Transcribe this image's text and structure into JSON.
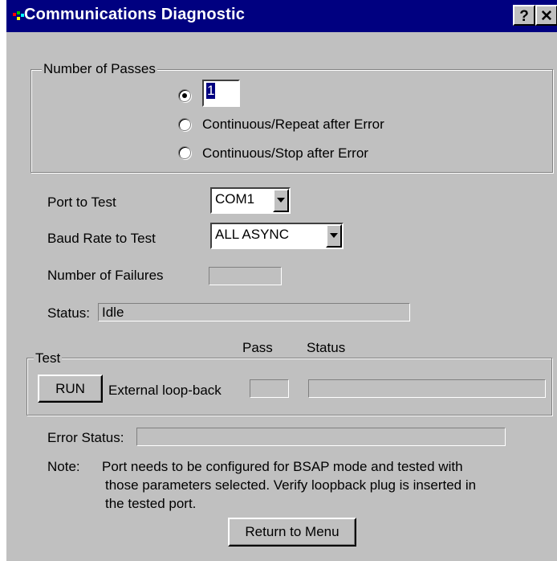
{
  "window": {
    "title": "Communications Diagnostic",
    "help_label": "?",
    "close_label": "✕"
  },
  "passes": {
    "group_title": "Number of Passes",
    "count_value": "1",
    "options": [
      "Continuous/Repeat after Error",
      "Continuous/Stop after  Error"
    ]
  },
  "port": {
    "label": "Port to Test",
    "value": "COM1"
  },
  "baud": {
    "label": "Baud Rate to Test",
    "value": "ALL ASYNC"
  },
  "failures": {
    "label": "Number of Failures",
    "value": ""
  },
  "status": {
    "label": "Status:",
    "value": "Idle"
  },
  "test": {
    "group_title": "Test",
    "pass_header": "Pass",
    "status_header": "Status",
    "run_label": "RUN",
    "test_name": "External loop-back",
    "pass_value": "",
    "status_value": ""
  },
  "error_status": {
    "label": "Error Status:",
    "value": ""
  },
  "note": {
    "label": "Note:",
    "lines": [
      "Port needs to be configured for BSAP mode and tested with",
      "those parameters selected. Verify loopback plug is inserted in",
      "the tested port."
    ]
  },
  "return_button": {
    "label": "Return to Menu"
  }
}
